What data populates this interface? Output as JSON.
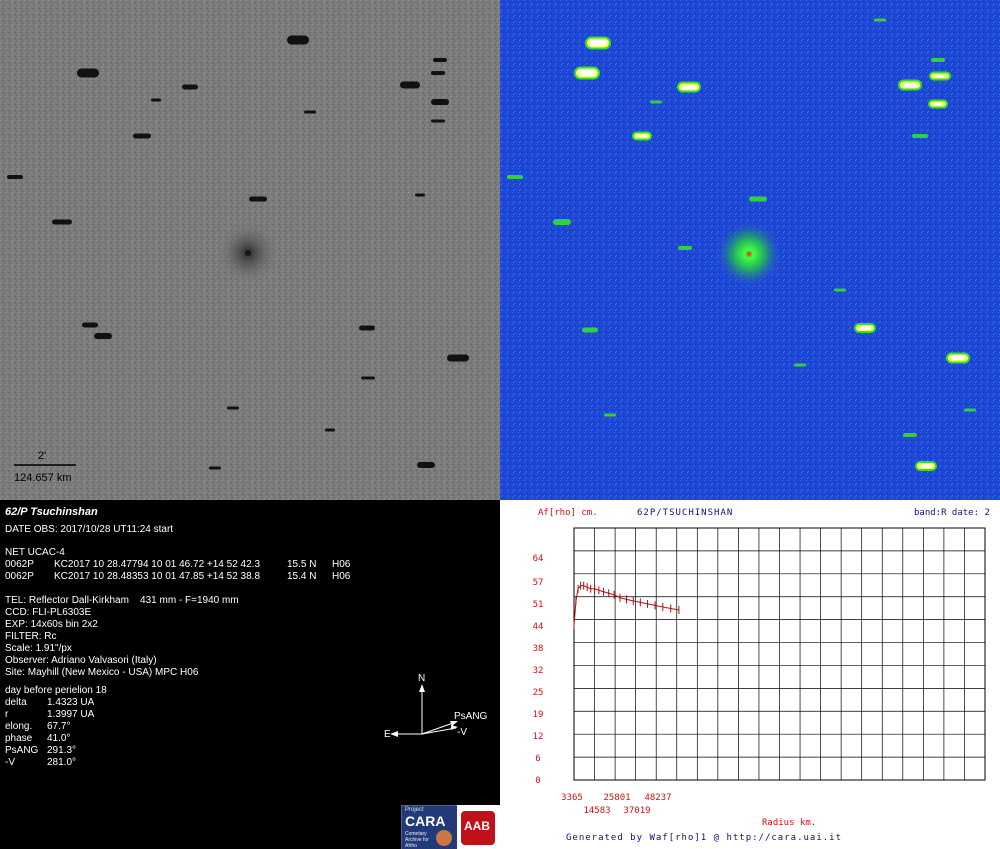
{
  "gray_panel": {
    "scale_arcmin": "2'",
    "scale_km": "124.657 km"
  },
  "info": {
    "title": "62/P Tsuchinshan",
    "date_obs": "DATE OBS: 2017/10/28 UT11:24 start",
    "net": "NET UCAC-4",
    "obs_lines": [
      {
        "id": "0062P",
        "code": "KC2017 10 28.47794 10 01 46.72 +14 52 42.3",
        "mag": "15.5 N",
        "site": "H06"
      },
      {
        "id": "0062P",
        "code": "KC2017 10 28.48353 10 01 47.85 +14 52 38.8",
        "mag": "15.4 N",
        "site": "H06"
      }
    ],
    "tel": "TEL: Reflector Dall-Kirkham    431 mm - F=1940 mm",
    "ccd": "CCD: FLI-PL6303E",
    "exp": "EXP: 14x60s bin 2x2",
    "filter": "FILTER: Rc",
    "scale": "Scale: 1.91\"/px",
    "observer": "Observer: Adriano Valvasori (Italy)",
    "site": "Site: Mayhill (New Mexico - USA) MPC H06",
    "perihelion": "day before perielion 18",
    "params": [
      {
        "k": "delta",
        "v": "1.4323 UA"
      },
      {
        "k": "r",
        "v": "1.3997 UA"
      },
      {
        "k": "elong.",
        "v": "67.7°"
      },
      {
        "k": "phase",
        "v": "41.0°"
      },
      {
        "k": "PsANG",
        "v": "291.3°"
      },
      {
        "k": "-V",
        "v": "281.0°"
      }
    ],
    "compass": {
      "n": "N",
      "e": "E",
      "psang": "PsANG",
      "v": "-V"
    },
    "logo_cara": "CARA",
    "logo_project": "Project",
    "logo_sub": "Cometary Archive for Afrho",
    "logo_aab": "AAB"
  },
  "chart_data": {
    "type": "line",
    "ylabel": "Af[rho] cm.",
    "title": "62P/TSUCHINSHAN",
    "band": "band:R date: 2",
    "xlabel": "Radius km.",
    "footer": "Generated by Waf[rho]1 @ http://cara.uai.it",
    "y_ticks": [
      "0",
      "6",
      "12",
      "19",
      "25",
      "32",
      "38",
      "44",
      "51",
      "57",
      "64"
    ],
    "x_ticks_top": [
      "3365",
      "25801",
      "48237"
    ],
    "x_ticks_bottom": [
      "14583",
      "37019"
    ],
    "xlim": [
      3365,
      179000
    ],
    "ylim": [
      0,
      83
    ],
    "series": [
      {
        "x": [
          3365,
          4200,
          5100,
          6200,
          7500,
          9000,
          10500,
          12200,
          14000,
          16000,
          18200,
          20500,
          23000,
          25800,
          28700,
          31700,
          34800,
          38000,
          41300,
          44700,
          48200
        ],
        "y": [
          51,
          59,
          63,
          64,
          64,
          63.5,
          63,
          63,
          62.5,
          62,
          61.5,
          61,
          60,
          59.5,
          59,
          58.5,
          58,
          57.5,
          57,
          56.5,
          56
        ]
      }
    ]
  }
}
